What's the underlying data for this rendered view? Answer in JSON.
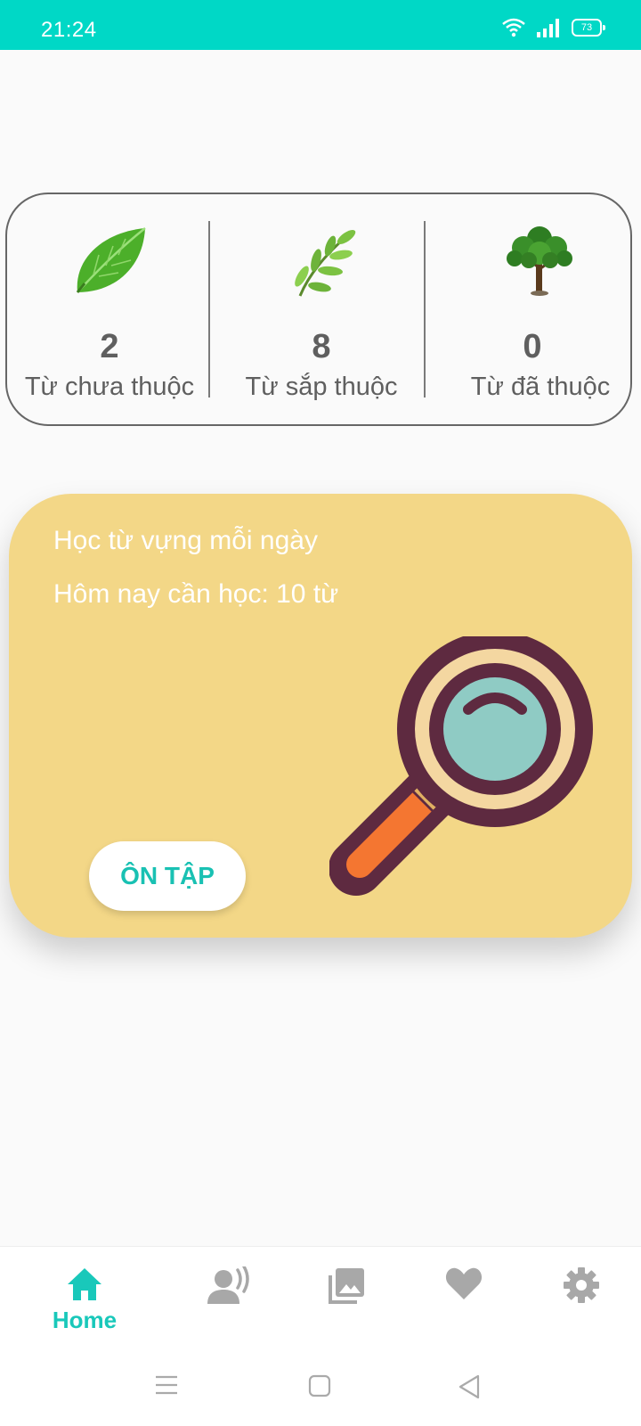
{
  "status_bar": {
    "time": "21:24",
    "battery": "73"
  },
  "stats": [
    {
      "icon": "leaf-icon",
      "value": "2",
      "label": "Từ chưa thuộc"
    },
    {
      "icon": "sprout-icon",
      "value": "8",
      "label": "Từ sắp thuộc"
    },
    {
      "icon": "tree-icon",
      "value": "0",
      "label": "Từ đã thuộc"
    }
  ],
  "study_card": {
    "title": "Học từ vựng mỗi ngày",
    "subtitle": "Hôm nay cần học: 10 từ",
    "button_label": "ÔN TẬP",
    "background": "#f3d787"
  },
  "bottom_nav": {
    "items": [
      {
        "icon": "home-icon",
        "label": "Home",
        "active": true
      },
      {
        "icon": "voice-icon",
        "label": "",
        "active": false
      },
      {
        "icon": "gallery-icon",
        "label": "",
        "active": false
      },
      {
        "icon": "heart-icon",
        "label": "",
        "active": false
      },
      {
        "icon": "gear-icon",
        "label": "",
        "active": false
      }
    ]
  },
  "colors": {
    "accent": "#00d8c6",
    "text_gray": "#5f5f5f",
    "inactive_icon": "#a8a8a8"
  }
}
